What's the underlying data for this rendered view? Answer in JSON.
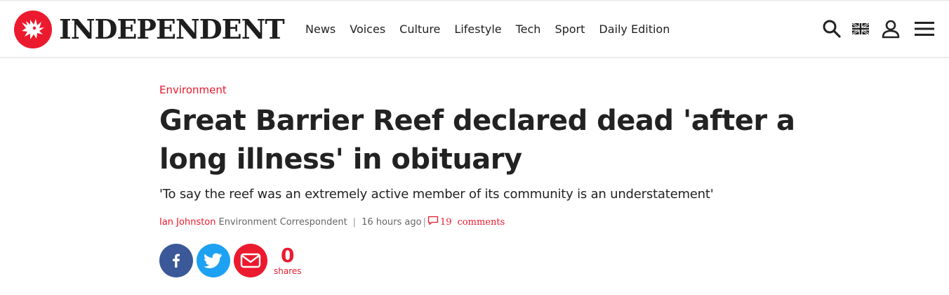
{
  "brand": {
    "name": "INDEPENDENT",
    "accent_color": "#ec1a2e",
    "logo_icon": "eagle-icon"
  },
  "nav": {
    "items": [
      "News",
      "Voices",
      "Culture",
      "Lifestyle",
      "Tech",
      "Sport",
      "Daily Edition"
    ]
  },
  "tools": {
    "search_icon": "search-icon",
    "flag_icon": "uk-flag-icon",
    "account_icon": "user-icon",
    "menu_icon": "hamburger-menu-icon"
  },
  "article": {
    "section": "Environment",
    "headline": "Great Barrier Reef declared dead 'after a long illness' in obituary",
    "standfirst": "'To say the reef was an extremely active member of its community is an understatement'",
    "author": "Ian Johnston",
    "author_role": "Environment Correspondent",
    "separator": "|",
    "time": "16 hours ago",
    "comments_count": "19",
    "comments_label": "comments"
  },
  "share": {
    "buttons": [
      {
        "name": "facebook",
        "icon": "facebook-icon",
        "color": "#3b5998"
      },
      {
        "name": "twitter",
        "icon": "twitter-icon",
        "color": "#1da1f2"
      },
      {
        "name": "email",
        "icon": "email-icon",
        "color": "#ec1a2e"
      }
    ],
    "count": "0",
    "count_label": "shares"
  }
}
